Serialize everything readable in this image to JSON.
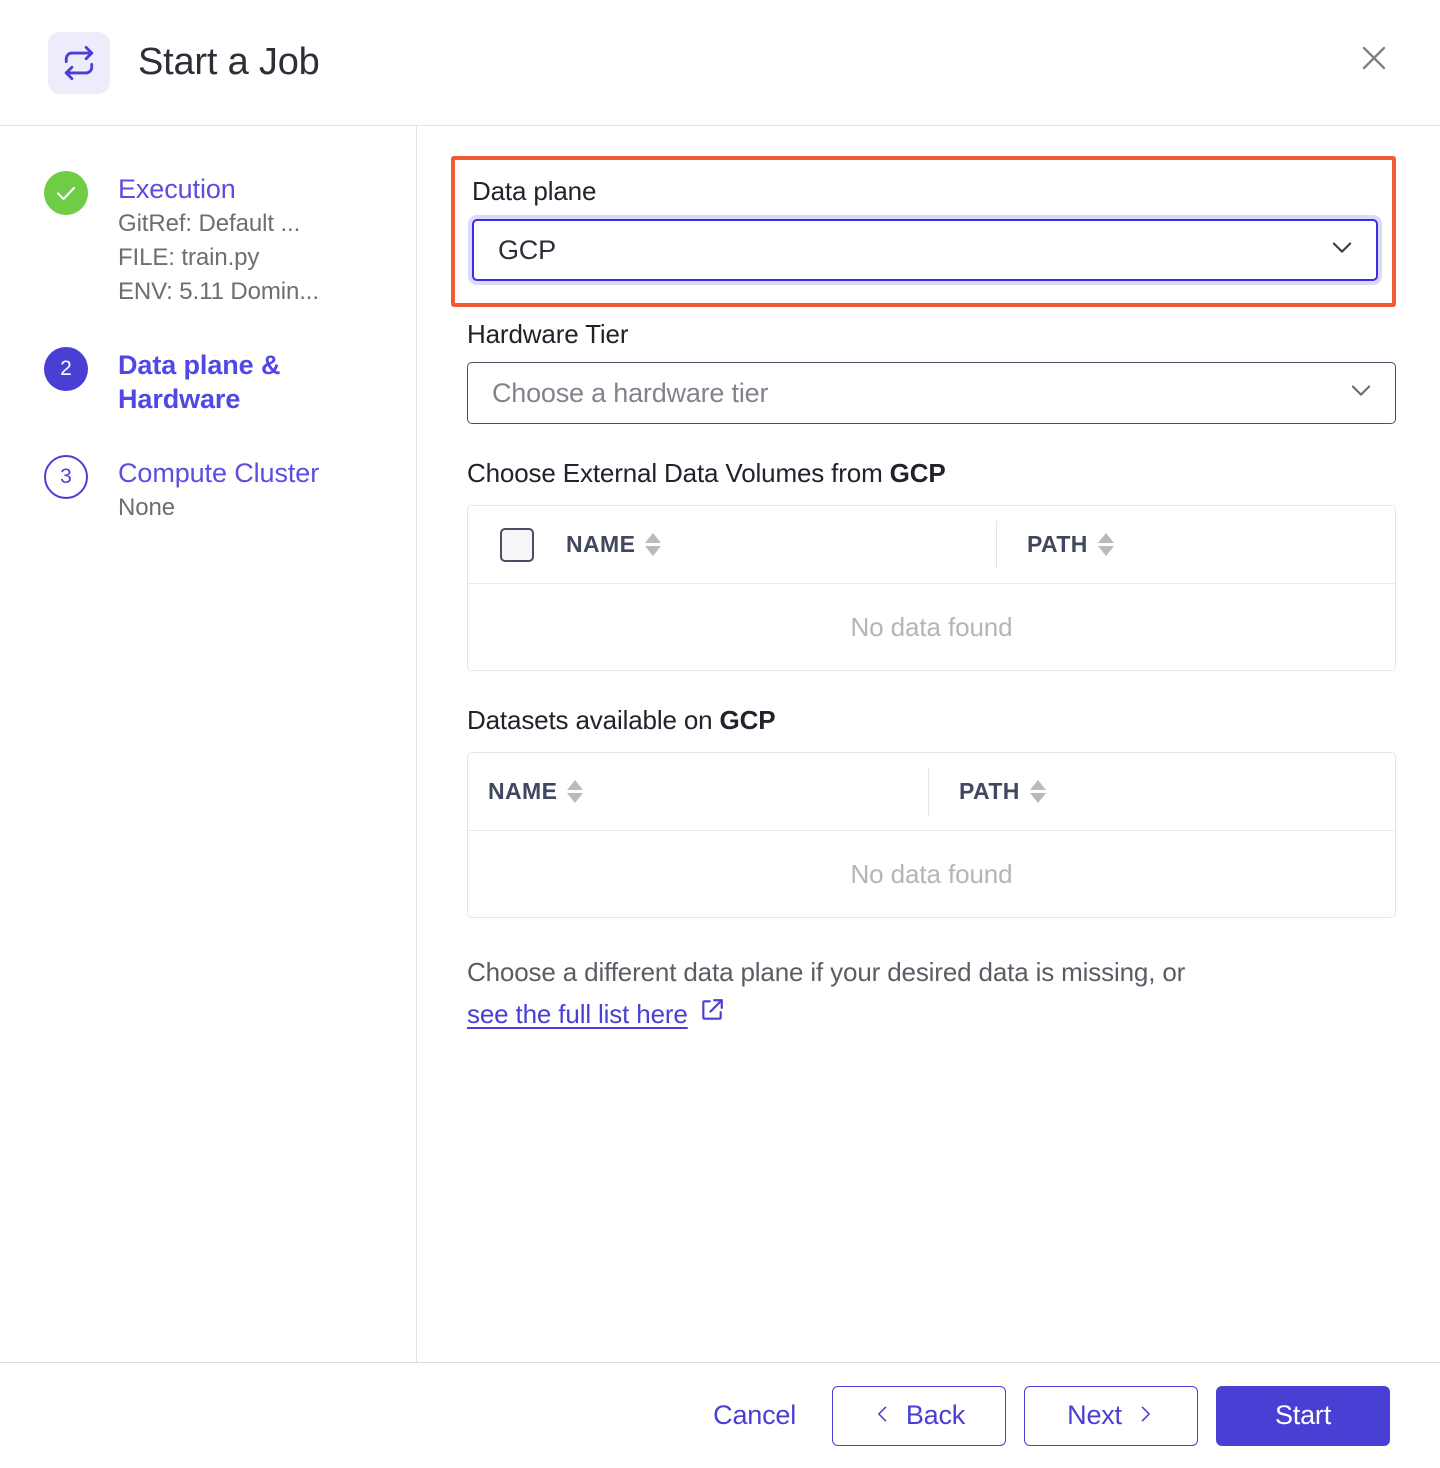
{
  "header": {
    "icon": "sync-icon",
    "title": "Start a Job",
    "close_icon": "close-icon"
  },
  "sidebar": {
    "steps": [
      {
        "badge": "check",
        "title": "Execution",
        "sub_lines": [
          "GitRef: Default ...",
          "FILE: train.py",
          "ENV: 5.11 Domin..."
        ]
      },
      {
        "badge": "2",
        "title": "Data plane & Hardware",
        "sub_lines": []
      },
      {
        "badge": "3",
        "title": "Compute Cluster",
        "sub_lines": [
          "None"
        ]
      }
    ]
  },
  "main": {
    "data_plane": {
      "label": "Data plane",
      "value": "GCP",
      "chevron_icon": "chevron-down-icon",
      "highlighted": true
    },
    "hardware_tier": {
      "label": "Hardware Tier",
      "placeholder": "Choose a hardware tier",
      "chevron_icon": "chevron-down-icon"
    },
    "volumes_section": {
      "title_prefix": "Choose External Data Volumes from ",
      "title_emphasis": "GCP",
      "columns": [
        "NAME",
        "PATH"
      ],
      "empty_text": "No data found",
      "has_checkbox": true
    },
    "datasets_section": {
      "title_prefix": "Datasets available on ",
      "title_emphasis": "GCP",
      "columns": [
        "NAME",
        "PATH"
      ],
      "empty_text": "No data found",
      "has_checkbox": false
    },
    "hint": {
      "text": "Choose a different data plane if your desired data is missing, or",
      "link_text": "see the full list here",
      "link_icon": "external-link-icon"
    }
  },
  "footer": {
    "cancel": "Cancel",
    "back": "Back",
    "next": "Next",
    "start": "Start",
    "back_icon": "chevron-left-icon",
    "next_icon": "chevron-right-icon"
  },
  "colors": {
    "accent": "#4a3fd4",
    "link": "#5b4ee0",
    "success": "#6ecc45",
    "annotation": "#ef5c33",
    "focus_border": "#3b2ee0"
  }
}
